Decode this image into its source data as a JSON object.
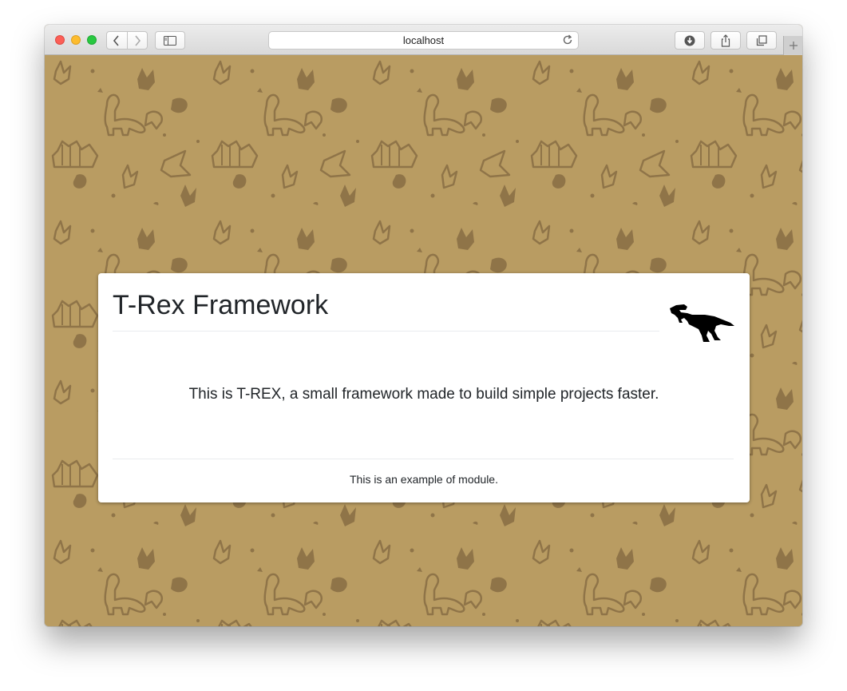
{
  "browser": {
    "address": "localhost",
    "icons": {
      "back": "chevron-left-icon",
      "forward": "chevron-right-icon",
      "sidebar": "sidebar-icon",
      "reload": "reload-icon",
      "downloads": "download-icon",
      "share": "share-icon",
      "tabs": "tabs-overview-icon",
      "new_tab": "plus-icon"
    }
  },
  "page": {
    "background_color": "#b99c62",
    "pattern_color": "#8a6f45",
    "card": {
      "title": "T-Rex Framework",
      "logo": "t-rex-silhouette-icon",
      "lead": "This is T-REX, a small framework made to build simple projects faster.",
      "module_text": "This is an example of module."
    }
  }
}
